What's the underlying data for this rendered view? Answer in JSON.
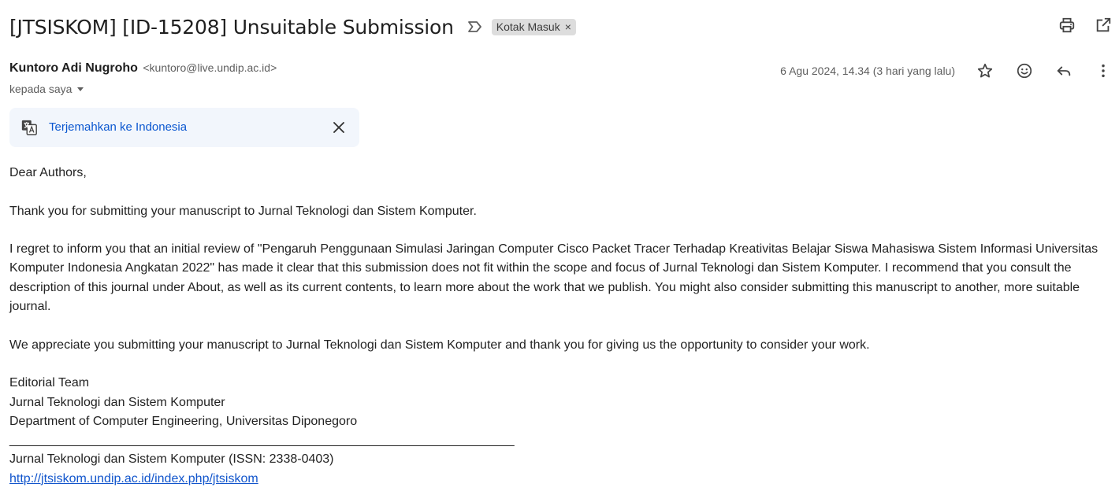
{
  "email": {
    "subject": "[JTSISKOM] [ID-15208] Unsuitable Submission",
    "label": "Kotak Masuk",
    "label_remove": "×",
    "sender_name": "Kuntoro Adi Nugroho",
    "sender_email": "<kuntoro@live.undip.ac.id>",
    "recipient": "kepada saya",
    "timestamp": "6 Agu 2024, 14.34 (3 hari yang lalu)",
    "translate_link": "Terjemahkan ke Indonesia"
  },
  "body": {
    "greeting": "Dear Authors,",
    "para1": "Thank you for submitting your manuscript to Jurnal Teknologi dan Sistem Komputer.",
    "para2": "I regret to inform you that an initial review of \"Pengaruh Penggunaan Simulasi Jaringan Computer Cisco Packet Tracer Terhadap Kreativitas Belajar Siswa Mahasiswa Sistem Informasi Universitas Komputer Indonesia Angkatan 2022\" has made it clear that this submission does not fit within the scope and focus of Jurnal Teknologi dan Sistem Komputer. I recommend that you consult the description of this journal under About, as well as its current contents, to learn more about the work that we publish. You might also consider submitting this manuscript to another, more suitable journal.",
    "para3": "We appreciate you submitting your manuscript to Jurnal Teknologi dan Sistem Komputer and thank you for giving us the opportunity to consider your work.",
    "sig1": "Editorial Team",
    "sig2": "Jurnal Teknologi dan Sistem Komputer",
    "sig3": "Department of Computer Engineering, Universitas Diponegoro",
    "divider": "________________________________________________________________________",
    "footer": "Jurnal Teknologi dan Sistem Komputer (ISSN: 2338-0403)",
    "link": "http://jtsiskom.undip.ac.id/index.php/jtsiskom"
  },
  "icons": {
    "importance": "label-important-outline-icon",
    "print": "print-icon",
    "open_new_window": "open-in-new-icon",
    "star": "star-outline-icon",
    "emoji": "emoji-icon",
    "reply": "reply-icon",
    "more": "more-vert-icon",
    "translate": "translate-icon",
    "close": "close-icon",
    "dropdown": "caret-down-icon"
  },
  "colors": {
    "link_blue": "#0b57d0",
    "translate_bg": "#f2f6fc",
    "chip_bg": "#dddddd"
  }
}
